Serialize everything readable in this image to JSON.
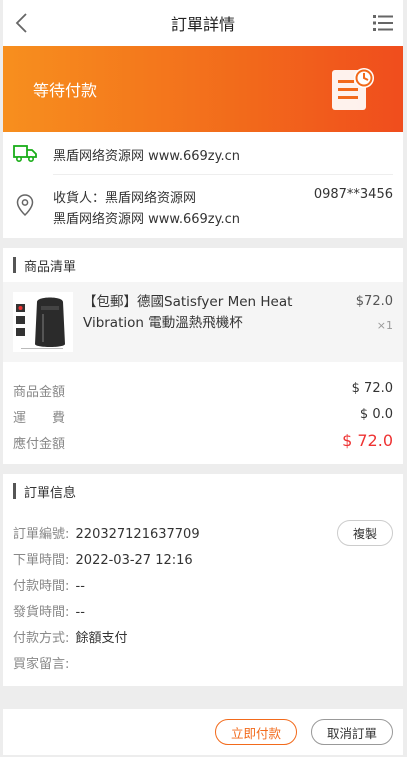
{
  "header": {
    "title": "訂單詳情",
    "back_icon": "chevron-left-icon",
    "menu_icon": "list-menu-icon"
  },
  "status": {
    "label": "等待付款",
    "icon": "order-clock-icon",
    "colors": {
      "from": "#f78f1e",
      "to": "#f04d1d"
    }
  },
  "shipping": {
    "line": "黑盾网络资源网 www.669zy.cn",
    "receiver_label": "收貨人：",
    "receiver_name": "黑盾网络资源网",
    "phone": "0987**3456",
    "address": "黑盾网络资源网 www.669zy.cn"
  },
  "goods_section": {
    "title": "商品清單"
  },
  "product": {
    "name": "【包郵】德國Satisfyer Men Heat Vibration 電動溫熱飛機杯",
    "price": "$72.0",
    "qty": "×1"
  },
  "amounts": {
    "goods_label": "商品金額",
    "goods_value": "$ 72.0",
    "shipping_label": "運費",
    "shipping_value": "$ 0.0",
    "pay_label": "應付金額",
    "pay_value": "$ 72.0",
    "accent": "#e33333"
  },
  "order_section": {
    "title": "訂單信息"
  },
  "order_info": {
    "order_no_label": "訂單編號:",
    "order_no": "220327121637709",
    "copy_label": "複製",
    "created_label": "下單時間:",
    "created": "2022-03-27 12:16",
    "paid_label": "付款時間:",
    "paid": "--",
    "shipped_label": "發貨時間:",
    "shipped": "--",
    "method_label": "付款方式:",
    "method": "餘額支付",
    "remark_label": "買家留言:",
    "remark": ""
  },
  "actions": {
    "pay": "立即付款",
    "cancel": "取消訂單"
  }
}
